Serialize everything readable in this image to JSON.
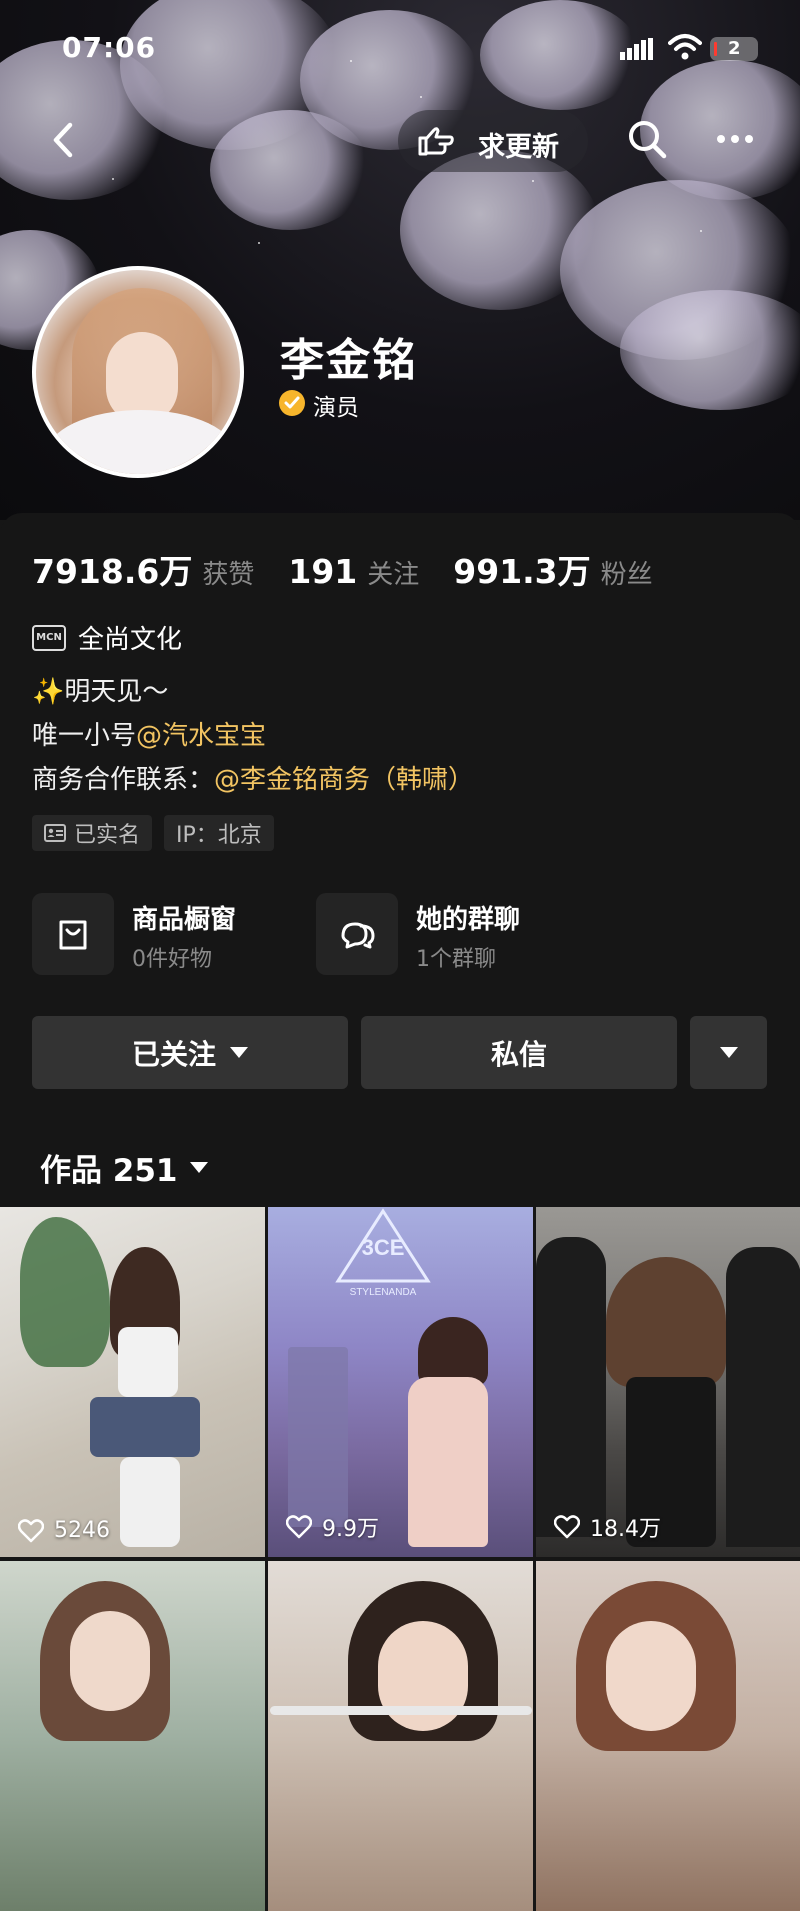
{
  "status_bar": {
    "time": "07:06",
    "battery": "2"
  },
  "nav": {
    "update_label": "求更新"
  },
  "profile": {
    "name": "李金铭",
    "verify_label": "演员"
  },
  "stats": [
    {
      "value": "7918.6万",
      "label": "获赞"
    },
    {
      "value": "191",
      "label": "关注"
    },
    {
      "value": "991.3万",
      "label": "粉丝"
    }
  ],
  "mcn": {
    "badge": "MCN",
    "label": "全尚文化"
  },
  "bio": {
    "line1": "✨明天见～",
    "line2_prefix": "唯一小号",
    "line2_mention": "@汽水宝宝",
    "line3_prefix": "商务合作联系：",
    "line3_mention": "@李金铭商务（韩啸）"
  },
  "tags": {
    "realname": "已实名",
    "ip": "IP：北京"
  },
  "shortcuts": [
    {
      "title": "商品橱窗",
      "sub": "0件好物"
    },
    {
      "title": "她的群聊",
      "sub": "1个群聊"
    }
  ],
  "actions": {
    "follow": "已关注",
    "message": "私信"
  },
  "works": {
    "label": "作品 251"
  },
  "grid": [
    {
      "likes": "5246"
    },
    {
      "likes": "9.9万",
      "brand": "3CE",
      "brand_sub": "STYLENANDA"
    },
    {
      "likes": "18.4万"
    },
    {
      "likes": ""
    },
    {
      "likes": ""
    },
    {
      "likes": ""
    }
  ]
}
